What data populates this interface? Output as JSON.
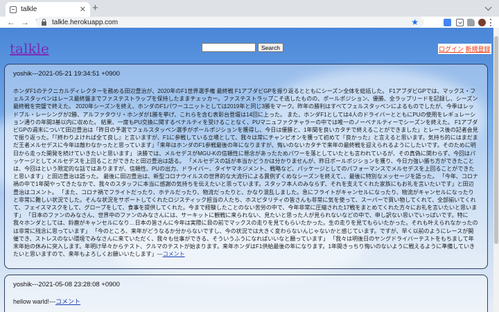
{
  "browser": {
    "tab_title": "talkle",
    "url": "talkle.herokuapp.com"
  },
  "site": {
    "title": "talkle",
    "search_button": "Search",
    "search_value": "",
    "login": "ログイン",
    "register": "新規登録"
  },
  "posts": [
    {
      "meta": "yoshik---2021-05-21 19:34:51 +0900",
      "body": "ホンダF1のテクニカルディレクターを務める田辺豊治が、2020年のF1世界選手権 最終戦 F1アブダビGPを振り返るとともにシーズン全体を総括した。 F1アブダビGPでは、マックス・フェルスタッペンはレース最終盤までファステストラップを保持したままチェッカー。ファステストラップこそ逃したものの、ポールポジション、優勝、全ラップリードを記録し、シーズン最終戦を完璧で終えた。 2020年シーズンを終え、ホンダのF1パワーユニットとしては2019年と同じ3勝をマーク。昨年の勝利はすべてフェルスタッペンによるものでしたが、今季はレッドブル・レーシングが2勝、アルファタウリ・ホンダが1勝を挙げ、これらを含む表彰台登壇は14回に上った。 また、ホンダF1としては4人のドライバーとともにPUの使用をレギュレーション通りの年間3基以内に収めた。 結果、一度もPU交換に関するペナルティを受けることなく、PUマニュファクチャラーの中では唯一のノーペナルティーでシーズンを終えた。 F1アブダビGPの週末について田辺豊治は「昨日の予選でフェルスタッペン選手がポールポジションを獲得し、今日は優勝と、1年間を良いカタチで終えることができました」とレース後の記者会見で振り返った。「『終わりよければ全て良し』と言いますが、F1に参戦している立場として、我々は常にチャンピオンを獲って初めて『良かった』と言えると思います。気持ち的にはまだまだ王者メルセデスに今年は敵わなかったと思っています」「来年はホンダのF1参戦最後の年になりますが、悔いのないカタチで来年の最終戦を迎えられるようにしたいです。そのために明日から走った開発を続けていきたいと思います」 決勝では、メルセデスがMGU-Kの信頼性に懸念があったためパワーを落としていたとも言われているが、その真偽に関わらず、今回はパッケージとしてメルセデスを上回ることができたと田辺豊治は語る。 「メルセデスの話が本当かどうかは分かりませんが、昨日ポールポジションを獲り、今日力強い勝ち方ができたことは、今回はという限定的な話ではありますが、信頼性、PUの出力、ドライバー、タイヤマネジメント、戦略など、パッケージとしてのパフォーマンスでメルセデスを上回ることができたと思います」と田辺豊治は語った。 最後に田辺豊治は、新型コロナウイルスの世界的な大流行による異例ずくめなシーズンを終えて、、最後に特別なメッセージを語った。 「今年、コロナ禍の中で1年間やってきたなかで、我々のスタッフに本当に感謝の気持ちを伝えたいと思っています。スタッフ本人のみならず、それを支えてくれた家族にもお礼を言いたいです」と田辺豊治はコメント。 「また、コロナ禍でフライトだったり、ホテルだったり、物流だったりと、かなり混乱しました。急にフライトがキャンセルになったり、物流がキャンセルになったりと非常に難しい状況でした。そんな状況をサポートしてくれたロジスティック担当の人たち、ホスピタリティの皆さんも非常に気を使って、スーパーで買い物してくれて、全部揃いてくれて、フェイスマスクをして、グローブをして、食事を提供してくれた。今まで経験したことのない苦労の中で、今年非常に圧縮された17戦をまとめてくれた方々にお礼を言いたいと思います」 「日本のファンのみなさん、世界中のファンのみなさんには、サーキットに観戦に来られない、見たいと思った人が見られないなどの中で、申し訳ない思いでいっぱいです。特に我々ホンダとしては、鈴鹿がキャンセルになり…日本の皆さんに今年は実際に目の前でマックスの走りを見てもらいたかった。生の走りを見てもらいたかった。それも叶えられなかったのは非常に残念に思っています」 「今のところ、来年がどうなるか分からないですし、今の状況では大きく変わらないんじゃないかと感じています。ですが、早く以前のようにレースが開催でき、ストレスのない環境でみなさんに来ていただく、我々も仕事ができる、そういうふうになればいいなと願っています」 「我々は明後日のヤングドライバーテストをもちまして年末年始の休みに突入します。年明け早々からテスト、クルマのテストが始まります。来年ホンダはF1供給最後の年になります。1年間きっちり悔いのないように戦えるように準備していきたいと思いますので、来年もよろしくお願いいたします」",
      "comment_label": "コメント"
    },
    {
      "meta": "yoshik---2021-05-08 23:28:08 +0900",
      "body": "hellow warld!",
      "comment_label": "コメント"
    }
  ],
  "separator": "---"
}
